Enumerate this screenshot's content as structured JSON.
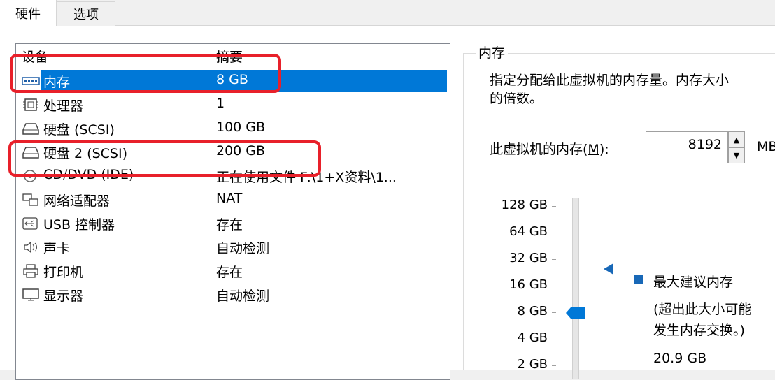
{
  "tabs": [
    {
      "label": "硬件",
      "active": true
    },
    {
      "label": "选项",
      "active": false
    }
  ],
  "device_list": {
    "columns": {
      "device": "设备",
      "summary": "摘要"
    },
    "rows": [
      {
        "icon": "memory-icon",
        "name": "内存",
        "summary": "8 GB",
        "selected": true
      },
      {
        "icon": "processor-icon",
        "name": "处理器",
        "summary": "1"
      },
      {
        "icon": "hard-disk-icon",
        "name": "硬盘 (SCSI)",
        "summary": "100 GB"
      },
      {
        "icon": "hard-disk-icon",
        "name": "硬盘 2 (SCSI)",
        "summary": "200 GB"
      },
      {
        "icon": "cd-dvd-icon",
        "name": "CD/DVD (IDE)",
        "summary": "正在使用文件 F:\\1+X资料\\1..."
      },
      {
        "icon": "network-adapter-icon",
        "name": "网络适配器",
        "summary": "NAT"
      },
      {
        "icon": "usb-controller-icon",
        "name": "USB 控制器",
        "summary": "存在"
      },
      {
        "icon": "sound-card-icon",
        "name": "声卡",
        "summary": "自动检测"
      },
      {
        "icon": "printer-icon",
        "name": "打印机",
        "summary": "存在"
      },
      {
        "icon": "display-icon",
        "name": "显示器",
        "summary": "自动检测"
      }
    ]
  },
  "memory_panel": {
    "title": "内存",
    "description_line1": "指定分配给此虚拟机的内存量。内存大小",
    "description_line2": "的倍数。",
    "input_label": "此虚拟机的内存(M):",
    "input_value": "8192",
    "unit": "MB",
    "scale_labels": [
      "128 GB",
      "64 GB",
      "32 GB",
      "16 GB",
      "8 GB",
      "4 GB",
      "2 GB"
    ],
    "current_level": "8 GB",
    "legend_max_recommended": "最大建议内存",
    "note_line1": "(超出此大小可能",
    "note_line2": "发生内存交换。)",
    "max_recommended_value": "20.9 GB"
  },
  "colors": {
    "selection": "#0078d7",
    "annotation": "#e8202a",
    "recommended": "#1868b7",
    "slider_thumb": "#0078d7"
  }
}
